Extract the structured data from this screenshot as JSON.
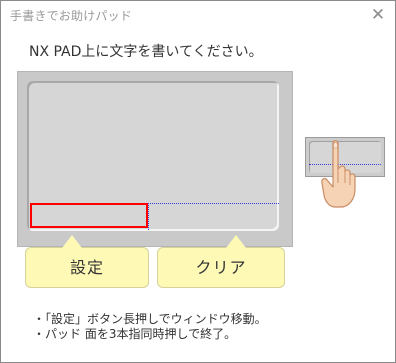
{
  "window": {
    "title": "手書きでお助けパッド",
    "close_icon": "close-icon"
  },
  "instruction": "NX PAD上に文字を書いてください。",
  "callouts": {
    "setting_label": "設定",
    "clear_label": "クリア"
  },
  "notes": [
    "・「設定」ボタン長押しでウィンドウ移動。",
    "・パッド 面を3本指同時押しで終了。"
  ],
  "colors": {
    "setting_zone_border": "#ff0000",
    "zone_guide": "#3b3bd9",
    "callout_fill": "#fefab5",
    "pad_gray": "#d6d6d6"
  }
}
